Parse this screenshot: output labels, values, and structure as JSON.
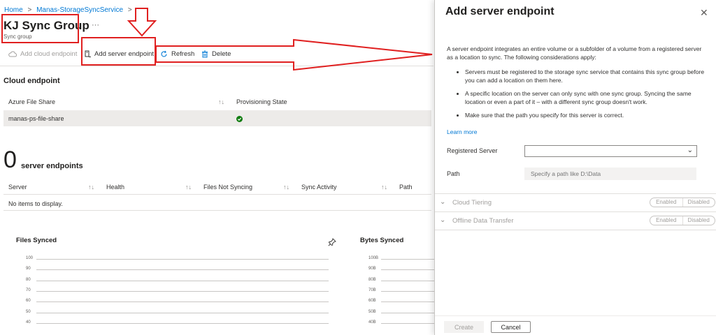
{
  "breadcrumb": {
    "home": "Home",
    "service": "Manas-StorageSyncService",
    "separator": ">"
  },
  "header": {
    "title": "KJ Sync Group",
    "subtitle": "Sync group",
    "more": "···"
  },
  "toolbar": {
    "add_cloud": "Add cloud endpoint",
    "add_server": "Add server endpoint",
    "refresh": "Refresh",
    "delete": "Delete"
  },
  "cloud": {
    "title": "Cloud endpoint",
    "columns": [
      "Azure File Share",
      "Provisioning State"
    ],
    "sort_glyph": "↑↓",
    "rows": [
      {
        "share": "manas-ps-file-share",
        "state": "succeeded"
      }
    ]
  },
  "servers": {
    "count": "0",
    "label": "server endpoints",
    "columns": [
      "Server",
      "Health",
      "Files Not Syncing",
      "Sync Activity",
      "Path"
    ],
    "empty": "No items to display."
  },
  "charts": {
    "files": {
      "title": "Files Synced",
      "ticks": [
        "100",
        "90",
        "80",
        "70",
        "60",
        "50",
        "40"
      ]
    },
    "bytes": {
      "title": "Bytes Synced",
      "ticks": [
        "100B",
        "90B",
        "80B",
        "70B",
        "60B",
        "50B",
        "40B"
      ]
    }
  },
  "panel": {
    "title": "Add server endpoint",
    "close": "✕",
    "intro": "A server endpoint integrates an entire volume or a subfolder of a volume from a registered server as a location to sync. The following considerations apply:",
    "bullets": [
      "Servers must be registered to the storage sync service that contains this sync group before you can add a location on them here.",
      "A specific location on the server can only sync with one sync group. Syncing the same location or even a part of it – with a different sync group doesn't work.",
      "Make sure that the path you specify for this server is correct."
    ],
    "learn_more": "Learn more",
    "registered_server_label": "Registered Server",
    "registered_server_value": "",
    "path_label": "Path",
    "path_placeholder": "Specify a path like D:\\Data",
    "cloud_tiering": "Cloud Tiering",
    "offline_transfer": "Offline Data Transfer",
    "enabled": "Enabled",
    "disabled": "Disabled",
    "create": "Create",
    "cancel": "Cancel"
  },
  "colors": {
    "accent": "#0078d4",
    "annotation": "#e02020",
    "success": "#107c10"
  }
}
